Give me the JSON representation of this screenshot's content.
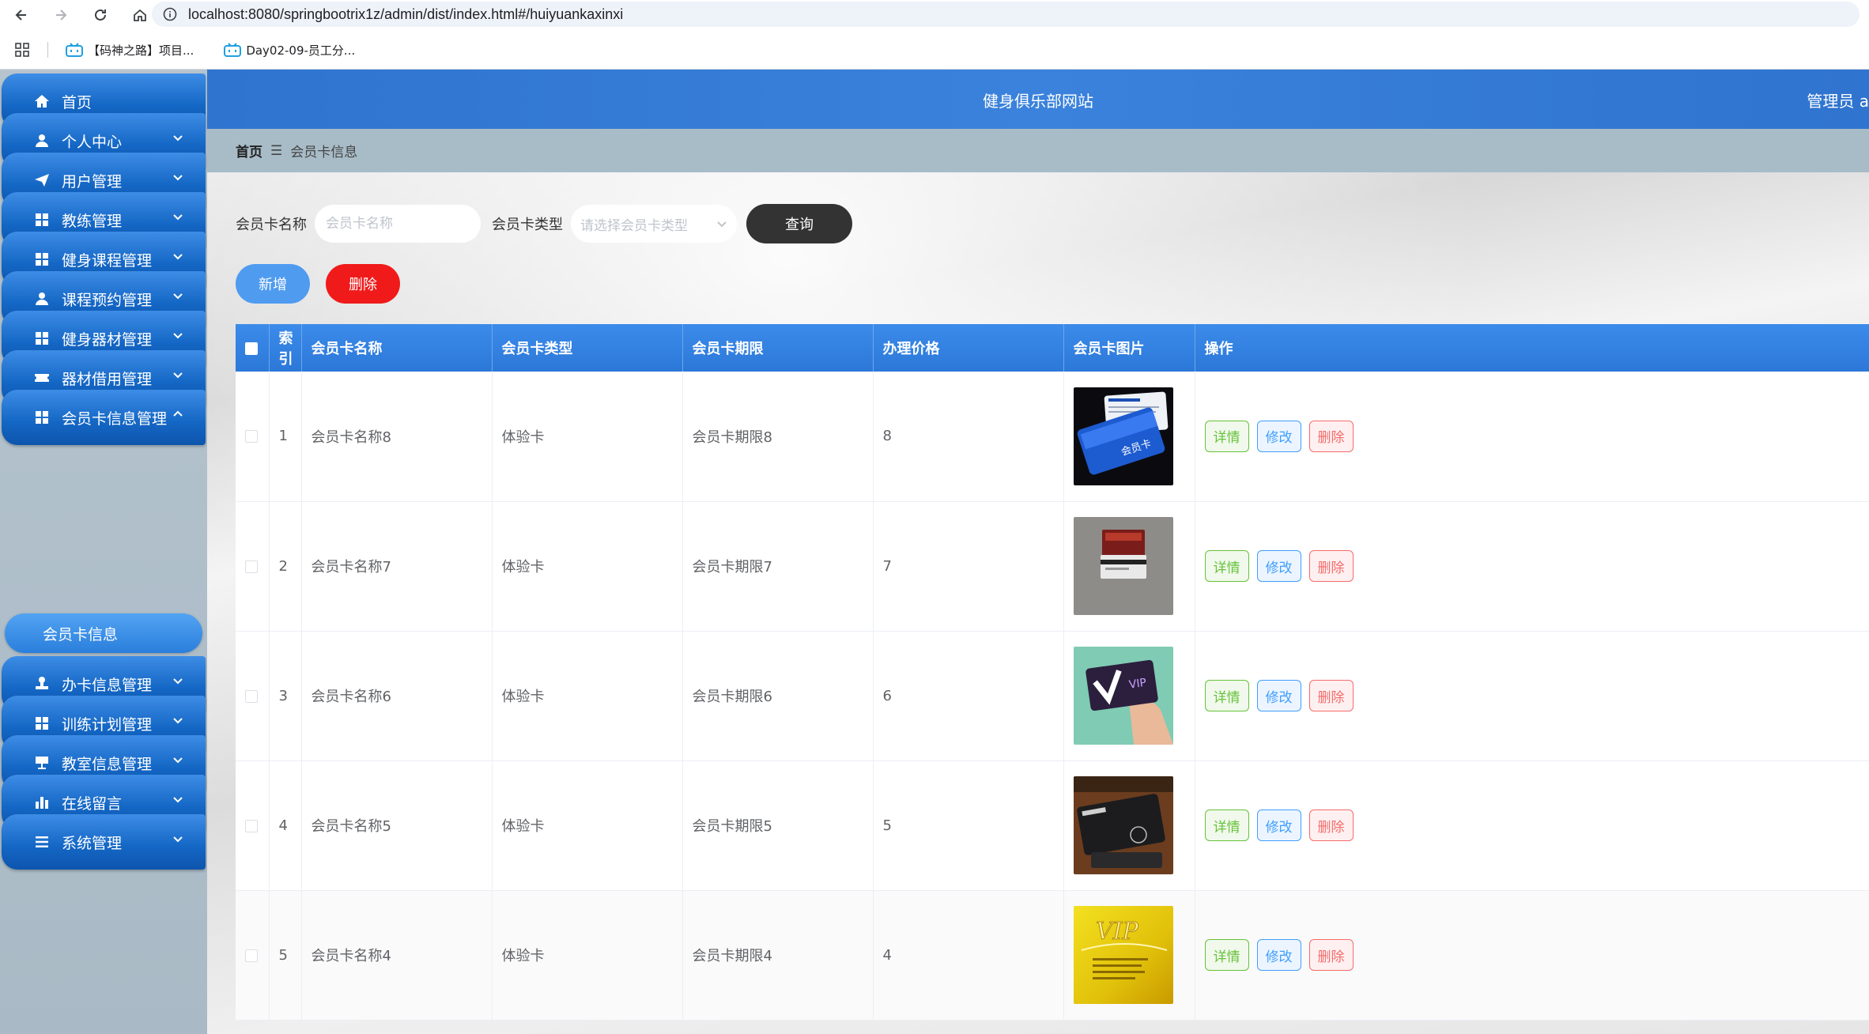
{
  "browser": {
    "url": "localhost:8080/springbootrix1z/admin/dist/index.html#/huiyuankaxinxi",
    "bookmarks": [
      {
        "label": "【码神之路】项目..."
      },
      {
        "label": "Day02-09-员工分..."
      }
    ]
  },
  "header": {
    "site_title": "健身俱乐部网站",
    "admin_label": "管理员 a"
  },
  "sidebar": {
    "items": [
      {
        "label": "首页",
        "icon": "home-icon"
      },
      {
        "label": "个人中心",
        "icon": "user-icon"
      },
      {
        "label": "用户管理",
        "icon": "send-icon"
      },
      {
        "label": "教练管理",
        "icon": "grid-icon"
      },
      {
        "label": "健身课程管理",
        "icon": "grid-icon"
      },
      {
        "label": "课程预约管理",
        "icon": "user-icon"
      },
      {
        "label": "健身器材管理",
        "icon": "grid-icon"
      },
      {
        "label": "器材借用管理",
        "icon": "ticket-icon"
      },
      {
        "label": "会员卡信息管理",
        "icon": "grid-icon"
      },
      {
        "label": "办卡信息管理",
        "icon": "stamp-icon"
      },
      {
        "label": "训练计划管理",
        "icon": "grid-icon"
      },
      {
        "label": "教室信息管理",
        "icon": "board-icon"
      },
      {
        "label": "在线留言",
        "icon": "bar-chart-icon"
      },
      {
        "label": "系统管理",
        "icon": "list-icon"
      }
    ],
    "active_sub": "会员卡信息"
  },
  "breadcrumb": {
    "home": "首页",
    "separator": "☰",
    "current": "会员卡信息"
  },
  "search": {
    "name_label": "会员卡名称",
    "name_placeholder": "会员卡名称",
    "type_label": "会员卡类型",
    "type_placeholder": "请选择会员卡类型",
    "query_label": "查询"
  },
  "actions": {
    "add_label": "新增",
    "delete_label": "删除"
  },
  "table": {
    "headers": {
      "index": "索引",
      "name": "会员卡名称",
      "type": "会员卡类型",
      "period": "会员卡期限",
      "price": "办理价格",
      "image": "会员卡图片",
      "ops": "操作"
    },
    "op_labels": {
      "detail": "详情",
      "edit": "修改",
      "remove": "删除"
    },
    "rows": [
      {
        "index": "1",
        "name": "会员卡名称8",
        "type": "体验卡",
        "period": "会员卡期限8",
        "price": "8",
        "image": "blue-membership-card-image"
      },
      {
        "index": "2",
        "name": "会员卡名称7",
        "type": "体验卡",
        "period": "会员卡期限7",
        "price": "7",
        "image": "red-card-on-gray-image"
      },
      {
        "index": "3",
        "name": "会员卡名称6",
        "type": "体验卡",
        "period": "会员卡期限6",
        "price": "6",
        "image": "vip-card-in-hand-image"
      },
      {
        "index": "4",
        "name": "会员卡名称5",
        "type": "体验卡",
        "period": "会员卡期限5",
        "price": "5",
        "image": "black-card-on-wood-image"
      },
      {
        "index": "5",
        "name": "会员卡名称4",
        "type": "体验卡",
        "period": "会员卡期限4",
        "price": "4",
        "image": "gold-vip-card-image"
      }
    ]
  },
  "colors": {
    "sidebar_menu": "#1466c4",
    "topbar": "#3a82dc",
    "table_header": "#2c78d8",
    "query_button": "#333333",
    "add_button": "#4f9bf0",
    "delete_button": "#f01a1a"
  }
}
